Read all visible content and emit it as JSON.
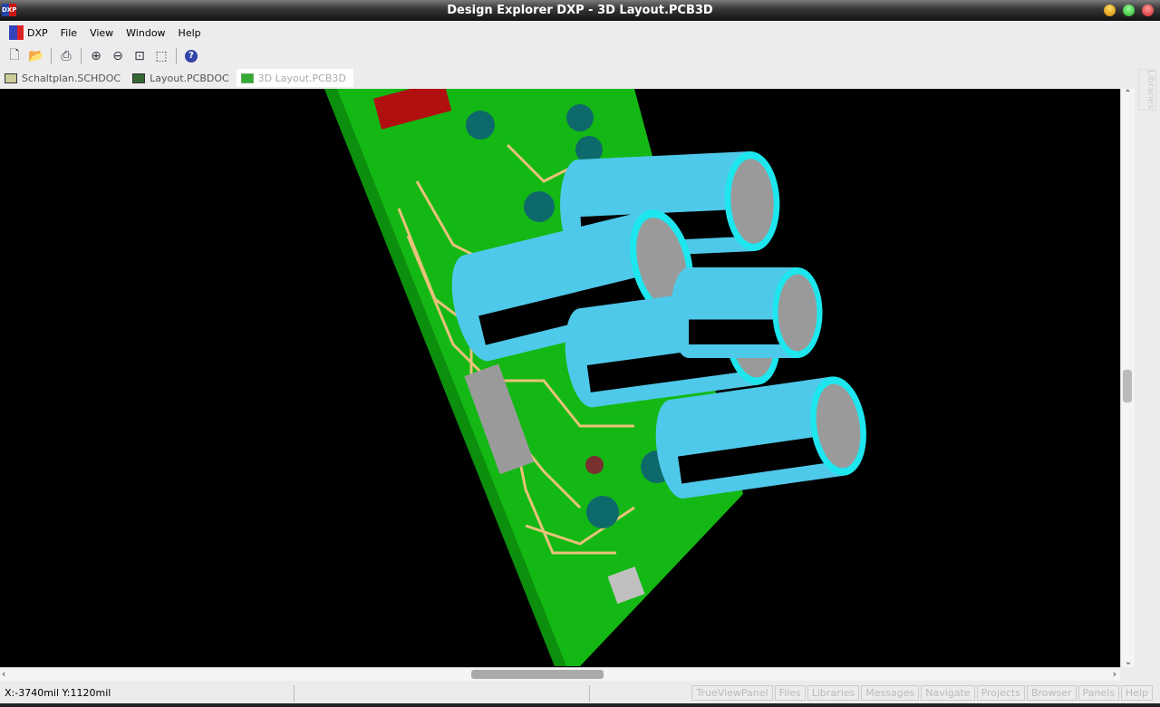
{
  "window": {
    "title": "Design Explorer DXP - 3D Layout.PCB3D",
    "app_icon_label": "DXP"
  },
  "menu": [
    "DXP",
    "File",
    "View",
    "Window",
    "Help"
  ],
  "toolbar": [
    "new-file-icon",
    "open-folder-icon",
    "print-icon",
    "zoom-in-icon",
    "zoom-out-icon",
    "zoom-fit-icon",
    "zoom-area-icon",
    "help-icon"
  ],
  "tabs": [
    {
      "label": "Schaltplan.SCHDOC",
      "active": false
    },
    {
      "label": "Layout.PCBDOC",
      "active": false
    },
    {
      "label": "3D Layout.PCB3D",
      "active": true
    }
  ],
  "side_panel": "Libraries",
  "status": {
    "coords": "X:-3740mil Y:1120mil"
  },
  "panel_buttons": [
    "TrueViewPanel",
    "Files",
    "Libraries",
    "Messages",
    "Navigate",
    "Projects",
    "Browser",
    "Panels",
    "Help"
  ],
  "colors": {
    "board": "#14b814",
    "trace": "#e8c27a",
    "capacitor": "#4fc9ea",
    "cap_ring": "#1ee6ee",
    "cap_top": "#9a9a9a"
  }
}
